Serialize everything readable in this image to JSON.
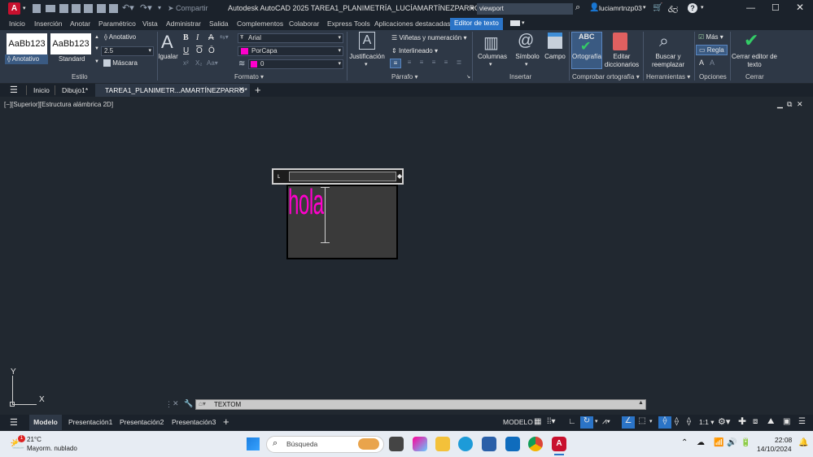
{
  "titlebar": {
    "app_logo": "A",
    "share_label": "Compartir",
    "title": "Autodesk AutoCAD 2025   TAREA1_PLANIMETRÍA_LUCÍAMARTÍNEZPARRO.DWG",
    "search_value": "viewport",
    "user": "luciamrtnzp03"
  },
  "ribbon_tabs": [
    "Inicio",
    "Inserción",
    "Anotar",
    "Paramétrico",
    "Vista",
    "Administrar",
    "Salida",
    "Complementos",
    "Colaborar",
    "Express Tools",
    "Aplicaciones destacadas",
    "Editor de texto"
  ],
  "ribbon": {
    "style_swatch_1": "AaBb123",
    "style_swatch_2": "AaBb123",
    "style_label_1": "Anotativo",
    "style_label_2": "Standard",
    "anotativo_label": "Anotativo",
    "text_height": "2.5",
    "mascara_label": "Máscara",
    "estilo_panel": "Estilo",
    "igualar_label": "Igualar",
    "font_value": "Arial",
    "color_value": "PorCapa",
    "layer_value": "0",
    "formato_panel": "Formato",
    "justificacion_label": "Justificación",
    "vinetas_label": "Viñetas y numeración",
    "interlineado_label": "Interlineado",
    "parrafo_panel": "Párrafo",
    "columnas_label": "Columnas",
    "simbolo_label": "Símbolo",
    "campo_label": "Campo",
    "insertar_panel": "Insertar",
    "ortografia_label": "Ortografía",
    "editar_dic_label": "Editar diccionarios",
    "comprobar_panel": "Comprobar ortografía",
    "buscar_label": "Buscar y reemplazar",
    "herramientas_panel": "Herramientas",
    "mas_label": "Más",
    "regla_label": "Regla",
    "opciones_panel": "Opciones",
    "cerrar_label": "Cerrar editor de texto",
    "cerrar_panel": "Cerrar",
    "abc_label": "ABC"
  },
  "doctabs": {
    "inicio": "Inicio",
    "dibujo": "Dibujo1*",
    "active": "TAREA1_PLANIMETR...AMARTÍNEZPARRO*"
  },
  "viewport_label": "[−][Superior][Estructura alámbrica 2D]",
  "canvas_text": "hola",
  "ucs": {
    "y": "Y",
    "x": "X"
  },
  "command": "TEXTOM",
  "layouts": [
    "Modelo",
    "Presentación1",
    "Presentación2",
    "Presentación3"
  ],
  "status": {
    "mode": "MODELO",
    "scale": "1:1"
  },
  "taskbar": {
    "temp": "21°C",
    "weather": "Mayorm. nublado",
    "search": "Búsqueda",
    "time": "22:08",
    "date": "14/10/2024"
  },
  "colors": {
    "accent": "#2b74c7",
    "text_magenta": "#ff00cc",
    "ok_green": "#33cc66"
  }
}
